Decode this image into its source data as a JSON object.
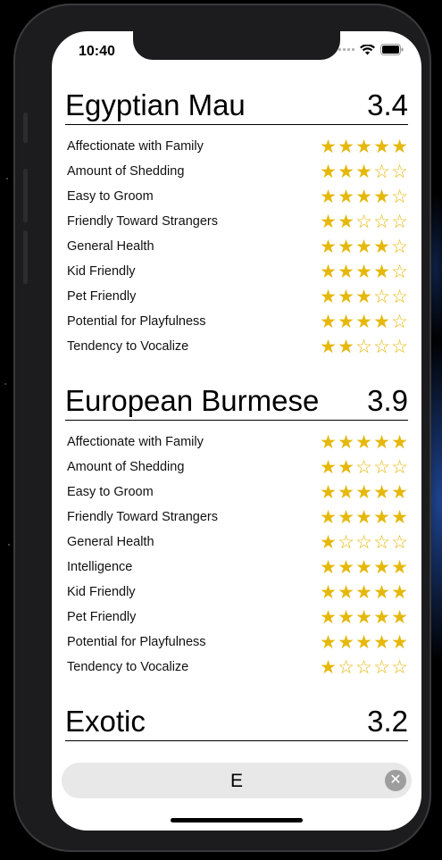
{
  "status": {
    "time": "10:40"
  },
  "breeds": [
    {
      "name": "Egyptian Mau",
      "score": "3.4",
      "traits": [
        {
          "label": "Affectionate with Family",
          "rating": 5
        },
        {
          "label": "Amount of Shedding",
          "rating": 3
        },
        {
          "label": "Easy to Groom",
          "rating": 4
        },
        {
          "label": "Friendly Toward Strangers",
          "rating": 2
        },
        {
          "label": "General Health",
          "rating": 4
        },
        {
          "label": "Kid Friendly",
          "rating": 4
        },
        {
          "label": "Pet Friendly",
          "rating": 3
        },
        {
          "label": "Potential for Playfulness",
          "rating": 4
        },
        {
          "label": "Tendency to Vocalize",
          "rating": 2
        }
      ]
    },
    {
      "name": "European Burmese",
      "score": "3.9",
      "traits": [
        {
          "label": "Affectionate with Family",
          "rating": 5
        },
        {
          "label": "Amount of Shedding",
          "rating": 2
        },
        {
          "label": "Easy to Groom",
          "rating": 5
        },
        {
          "label": "Friendly Toward Strangers",
          "rating": 5
        },
        {
          "label": "General Health",
          "rating": 1
        },
        {
          "label": "Intelligence",
          "rating": 5
        },
        {
          "label": "Kid Friendly",
          "rating": 5
        },
        {
          "label": "Pet Friendly",
          "rating": 5
        },
        {
          "label": "Potential for Playfulness",
          "rating": 5
        },
        {
          "label": "Tendency to Vocalize",
          "rating": 1
        }
      ]
    },
    {
      "name": "Exotic",
      "score": "3.2",
      "traits": []
    }
  ],
  "search": {
    "value": "E"
  },
  "colors": {
    "star": "#e5b80b",
    "background": "#ffffff",
    "search_bg": "#e8e8e8"
  },
  "icons": {
    "clear": "clear-icon",
    "wifi": "wifi-icon",
    "battery": "battery-icon",
    "signal": "signal-icon"
  }
}
